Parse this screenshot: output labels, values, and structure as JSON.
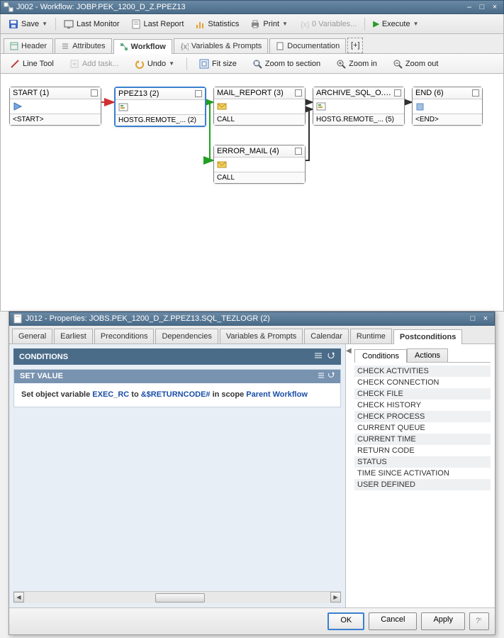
{
  "window": {
    "title": "J002 - Workflow: JOBP.PEK_1200_D_Z.PPEZ13",
    "min_icon": "–",
    "max_icon": "□",
    "close_icon": "×"
  },
  "toolbar": {
    "save": "Save",
    "last_monitor": "Last Monitor",
    "last_report": "Last Report",
    "statistics": "Statistics",
    "print": "Print",
    "variables": "0 Variables...",
    "execute": "Execute"
  },
  "tabs": {
    "header": "Header",
    "attributes": "Attributes",
    "workflow": "Workflow",
    "variables_prompts": "Variables & Prompts",
    "documentation": "Documentation",
    "add": "[+]"
  },
  "subtoolbar": {
    "line_tool": "Line Tool",
    "add_task": "Add task...",
    "undo": "Undo",
    "fit_size": "Fit size",
    "zoom_section": "Zoom to section",
    "zoom_in": "Zoom in",
    "zoom_out": "Zoom out"
  },
  "nodes": {
    "start": {
      "title": "START (1)",
      "footer": "<START>"
    },
    "ppez13": {
      "title": "PPEZ13 (2)",
      "footer": "HOSTG.REMOTE_... (2)"
    },
    "mail_report": {
      "title": "MAIL_REPORT (3)",
      "footer": "CALL"
    },
    "error_mail": {
      "title": "ERROR_MAIL (4)",
      "footer": "CALL"
    },
    "archive": {
      "title": "ARCHIVE_SQL_O... (5)",
      "footer": "HOSTG.REMOTE_... (5)"
    },
    "end": {
      "title": "END (6)",
      "footer": "<END>"
    }
  },
  "props": {
    "title": "J012 - Properties: JOBS.PEK_1200_D_Z.PPEZ13.SQL_TEZLOGR (2)",
    "tabs": {
      "general": "General",
      "earliest": "Earliest",
      "preconditions": "Preconditions",
      "dependencies": "Dependencies",
      "variables_prompts": "Variables & Prompts",
      "calendar": "Calendar",
      "runtime": "Runtime",
      "postconditions": "Postconditions"
    },
    "conditions_header": "CONDITIONS",
    "setvalue_header": "SET VALUE",
    "setvalue_text": {
      "pre": "Set object variable ",
      "var": "EXEC_RC",
      "to": " to ",
      "val": "&$RETURNCODE#",
      "inscope": " in scope ",
      "scope": "Parent Workflow"
    },
    "right_tabs": {
      "conditions": "Conditions",
      "actions": "Actions"
    },
    "cond_list": [
      "CHECK ACTIVITIES",
      "CHECK CONNECTION",
      "CHECK FILE",
      "CHECK HISTORY",
      "CHECK PROCESS",
      "CURRENT QUEUE",
      "CURRENT TIME",
      "RETURN CODE",
      "STATUS",
      "TIME SINCE ACTIVATION",
      "USER DEFINED"
    ],
    "buttons": {
      "ok": "OK",
      "cancel": "Cancel",
      "apply": "Apply"
    }
  }
}
